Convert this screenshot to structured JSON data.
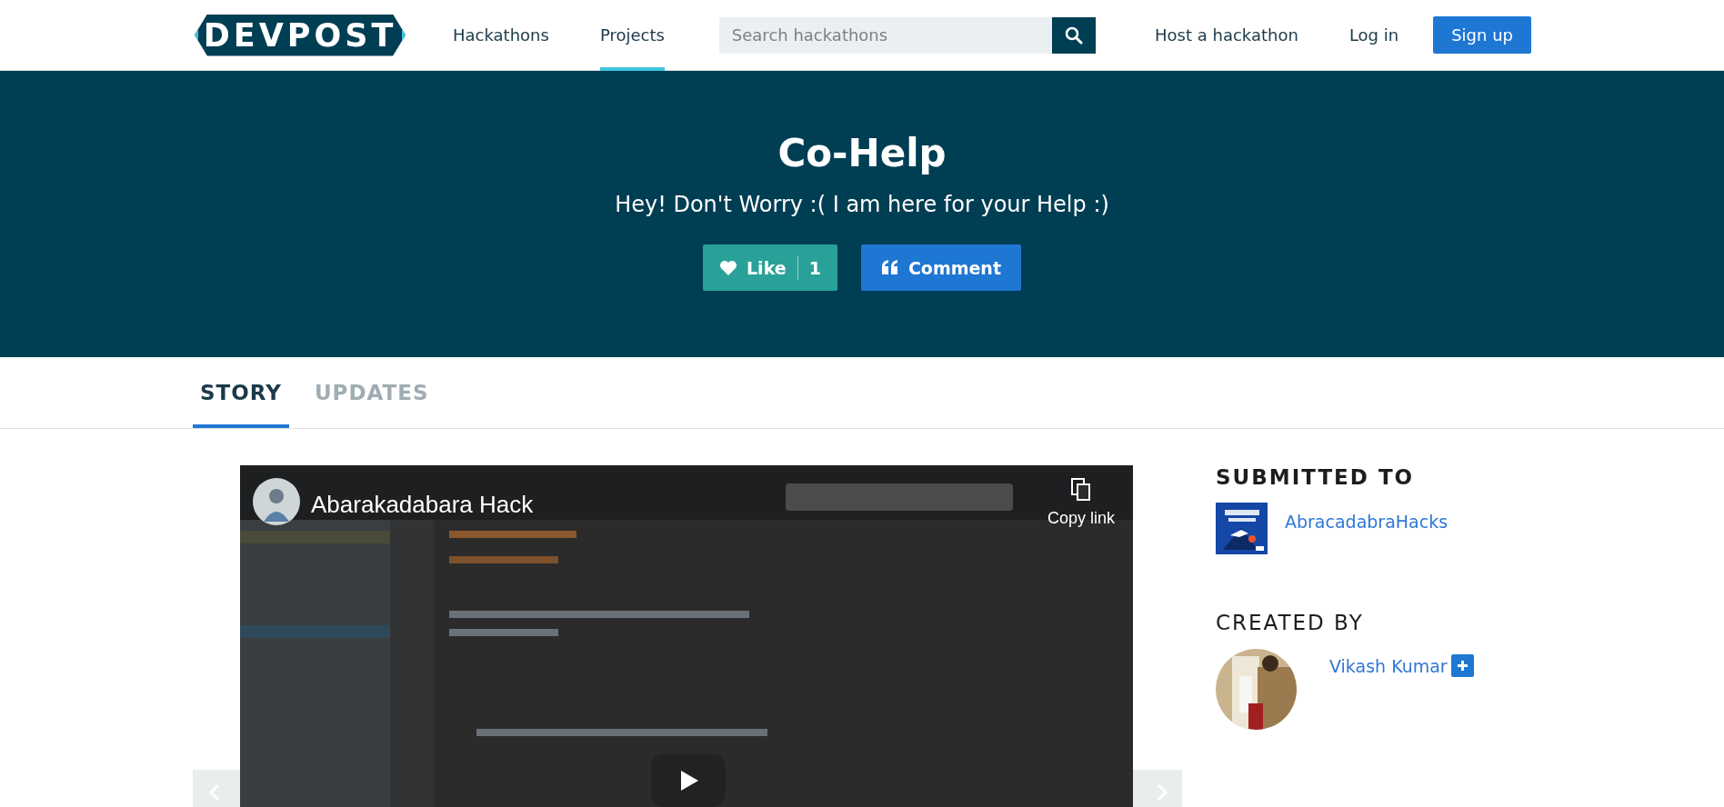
{
  "header": {
    "logo": "DEVPOST",
    "nav": [
      {
        "label": "Hackathons",
        "selected": false
      },
      {
        "label": "Projects",
        "selected": true
      }
    ],
    "search": {
      "placeholder": "Search hackathons"
    },
    "links": [
      "Host a hackathon",
      "Log in"
    ],
    "signup": "Sign up"
  },
  "hero": {
    "title": "Co-Help",
    "tagline": "Hey! Don't Worry :( I am here for your Help :)",
    "like": {
      "label": "Like",
      "count": "1"
    },
    "comment": "Comment"
  },
  "tabs": [
    {
      "label": "STORY",
      "selected": true
    },
    {
      "label": "UPDATES",
      "selected": false
    }
  ],
  "video": {
    "title": "Abarakadabara Hack",
    "copy_link": "Copy link"
  },
  "sidebar": {
    "submitted_heading": "SUBMITTED TO",
    "hackathon": "AbracadabraHacks",
    "created_heading": "CREATED BY",
    "creators": [
      {
        "name": "Vikash Kumar"
      }
    ]
  }
}
